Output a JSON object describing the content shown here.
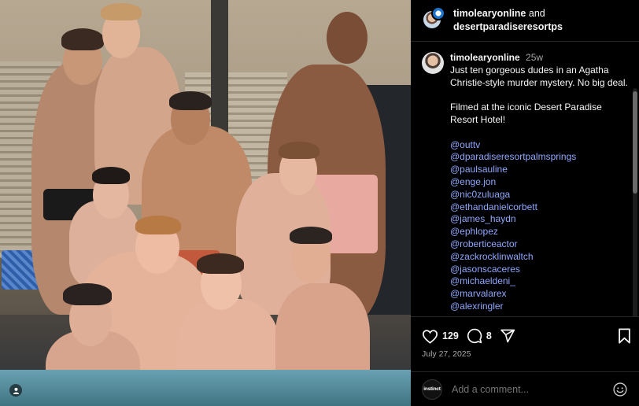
{
  "post": {
    "header": {
      "user1": "timolearyonline",
      "conjunction": "and",
      "user2": "desertparadiseresortps"
    },
    "caption": {
      "username": "timolearyonline",
      "time": "25w",
      "line1": "Just ten gorgeous dudes in an Agatha Christie-style murder mystery. No big deal.",
      "line2": "Filmed at the iconic Desert Paradise Resort Hotel!",
      "mentions": [
        "@outtv",
        "@dparadiseresortpalmsprings",
        "@paulsauline",
        "@enge.jon",
        "@nic0zuluaga",
        "@ethandanielcorbett",
        "@james_haydn",
        "@ephlopez",
        "@roberticeactor",
        "@zackrocklinwaltch",
        "@jasonscaceres",
        "@michaeldeni_",
        "@marvalarex",
        "@alexringler"
      ]
    },
    "actions": {
      "likes": "129",
      "comments": "8",
      "like_icon": "heart-icon",
      "comment_icon": "comment-bubble-icon",
      "share_icon": "paper-plane-icon",
      "save_icon": "bookmark-icon"
    },
    "date": "July 27, 2025",
    "comment_box": {
      "placeholder": "Add a comment...",
      "avatar_text": "instinct",
      "emoji_icon": "smiley-icon"
    }
  },
  "colors": {
    "background": "#000000",
    "mention": "#8fa8ff",
    "muted": "#a8a8a8",
    "divider": "#262626"
  }
}
